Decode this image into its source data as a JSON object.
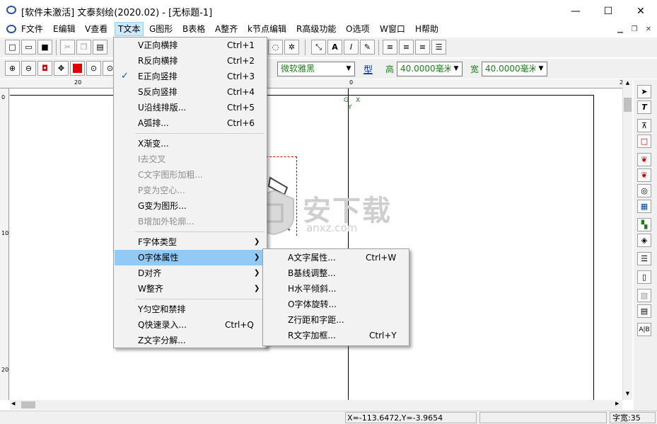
{
  "window": {
    "title": "[软件未激活] 文泰刻绘(2020.02) - [无标题-1]",
    "minimize": "—",
    "maximize": "☐",
    "close": "✕"
  },
  "menubar": {
    "items": [
      "F文件",
      "E编辑",
      "V查看",
      "T文本",
      "G图形",
      "B表格",
      "A整齐",
      "k节点编辑",
      "R高级功能",
      "O选项",
      "W窗口",
      "H帮助"
    ],
    "active_index": 3
  },
  "text_menu": {
    "items": [
      {
        "label": "V正向横排",
        "shortcut": "Ctrl+1"
      },
      {
        "label": "R反向横排",
        "shortcut": "Ctrl+2"
      },
      {
        "label": "E正向竖排",
        "shortcut": "Ctrl+3",
        "checked": true
      },
      {
        "label": "S反向竖排",
        "shortcut": "Ctrl+4"
      },
      {
        "label": "U沿线排版...",
        "shortcut": "Ctrl+5"
      },
      {
        "label": "A弧排...",
        "shortcut": "Ctrl+6"
      },
      {
        "label": "X渐变..."
      },
      {
        "label": "I去交叉",
        "disabled": true
      },
      {
        "label": "C文字图形加粗...",
        "disabled": true
      },
      {
        "label": "P变为空心...",
        "disabled": true
      },
      {
        "label": "G变为图形..."
      },
      {
        "label": "B增加外轮廓...",
        "disabled": true
      },
      {
        "label": "F字体类型"
      },
      {
        "label": "O字体属性",
        "highlighted": true
      },
      {
        "label": "D对齐"
      },
      {
        "label": "W整齐"
      },
      {
        "label": "Y匀空和禁排"
      },
      {
        "label": "Q快速录入...",
        "shortcut": "Ctrl+Q"
      },
      {
        "label": "Z文字分解..."
      }
    ],
    "check_glyph": "✓",
    "submenu_arrow": "❯"
  },
  "font_attr_submenu": {
    "items": [
      {
        "label": "A文字属性...",
        "shortcut": "Ctrl+W"
      },
      {
        "label": "B基线调整..."
      },
      {
        "label": "H水平倾斜..."
      },
      {
        "label": "O字体旋转..."
      },
      {
        "label": "Z行距和字距..."
      },
      {
        "label": "R文字加框...",
        "shortcut": "Ctrl+Y"
      }
    ]
  },
  "toolbar": {
    "font_name": "微软雅黑",
    "type_label": "型",
    "height_label": "高",
    "height_value": "40.0000毫米",
    "width_label": "宽",
    "width_value": "40.0000毫米"
  },
  "ruler": {
    "top_labels": [
      "20",
      "0",
      "20"
    ],
    "left_labels": [
      "0",
      "10",
      "20"
    ]
  },
  "canvas": {
    "axis_label_g": "G",
    "axis_label_x": "X",
    "axis_label_y": "Y",
    "watermark_main": "安下载",
    "watermark_sub": "anxz.com"
  },
  "status": {
    "coords": "X=-113.6472,Y=-3.9654",
    "char_width": "字宽:35"
  },
  "colors": {
    "accent_blue": "#0033cc",
    "green_text": "#1a7f1a",
    "menu_highlight": "#91c9f7"
  }
}
